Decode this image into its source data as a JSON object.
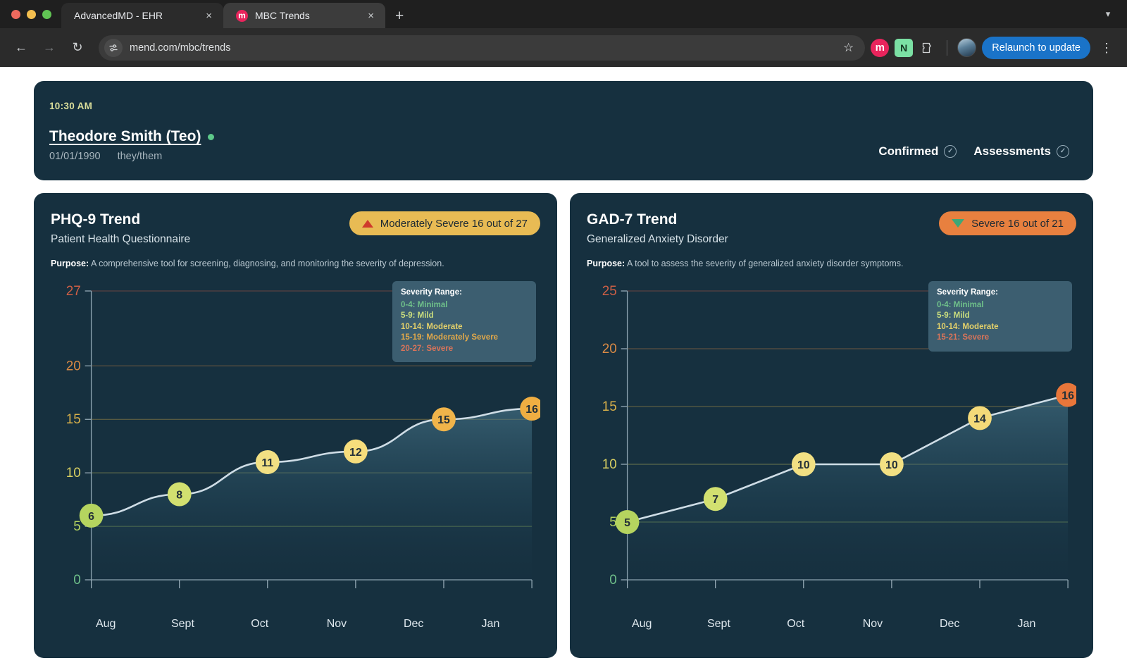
{
  "browser": {
    "tabs": [
      {
        "title": "AdvancedMD - EHR",
        "favicon": "",
        "active": false,
        "close_label": "×"
      },
      {
        "title": "MBC Trends",
        "favicon": "m",
        "active": true,
        "close_label": "×"
      }
    ],
    "new_tab_label": "+",
    "tabstrip_collapse_icon": "chevron-down-icon",
    "back_icon": "←",
    "forward_icon": "→",
    "reload_icon": "↻",
    "site_info_icon": "tune-icon",
    "url": "mend.com/mbc/trends",
    "bookmark_icon": "☆",
    "extensions": [
      {
        "name": "mend-extension",
        "glyph": "m",
        "color": "#e8245c"
      },
      {
        "name": "notion-extension",
        "glyph": "N",
        "color": "#7be0a4"
      },
      {
        "name": "extensions-puzzle",
        "glyph": "⬡",
        "color": "#d0d2d4"
      }
    ],
    "relaunch_label": "Relaunch to update",
    "menu_icon": "⋮"
  },
  "header": {
    "time": "10:30 AM",
    "patient_name": "Theodore Smith (Teo)",
    "online_status": "online",
    "dob": "01/01/1990",
    "pronouns": "they/them",
    "chips": [
      {
        "label": "Confirmed",
        "icon": "check-circle-icon"
      },
      {
        "label": "Assessments",
        "icon": "check-circle-icon"
      }
    ]
  },
  "colors": {
    "card_bg": "#16303f",
    "legend_bg": "#3c5e70",
    "accent_blue": "#1a73c8",
    "minimal": "#6fc08a",
    "mild": "#c9dd7e",
    "moderate": "#e3d06a",
    "moderately_severe": "#e0a84a",
    "severe": "#d9745a",
    "line": "#cfdde6"
  },
  "charts": [
    {
      "title": "PHQ-9 Trend",
      "subtitle": "Patient Health Questionnaire",
      "purpose_label": "Purpose:",
      "purpose_text": "A comprehensive tool for screening, diagnosing, and monitoring the severity of depression.",
      "badge": {
        "text": "Moderately Severe 16 out of 27",
        "bg": "#e8bb54",
        "arrow": "up",
        "arrow_color": "#cf3a2c"
      },
      "legend": {
        "title": "Severity Range:",
        "items": [
          {
            "text": "0-4: Minimal",
            "color": "#6fc08a"
          },
          {
            "text": "5-9: Mild",
            "color": "#c9dd7e"
          },
          {
            "text": "10-14: Moderate",
            "color": "#e3d06a"
          },
          {
            "text": "15-19: Moderately Severe",
            "color": "#e0a84a"
          },
          {
            "text": "20-27: Severe",
            "color": "#d9745a"
          }
        ]
      }
    },
    {
      "title": "GAD-7 Trend",
      "subtitle": "Generalized Anxiety Disorder",
      "purpose_label": "Purpose:",
      "purpose_text": "A tool to assess the severity of generalized anxiety disorder symptoms.",
      "badge": {
        "text": "Severe 16 out of 21",
        "bg": "#e8803f",
        "arrow": "down",
        "arrow_color": "#3ea777"
      },
      "legend": {
        "title": "Severity Range:",
        "items": [
          {
            "text": "0-4: Minimal",
            "color": "#6fc08a"
          },
          {
            "text": "5-9: Mild",
            "color": "#c9dd7e"
          },
          {
            "text": "10-14: Moderate",
            "color": "#e3d06a"
          },
          {
            "text": "15-21: Severe",
            "color": "#d9745a"
          }
        ]
      }
    }
  ],
  "chart_data": [
    {
      "type": "line",
      "title": "PHQ-9 Trend",
      "subtitle": "Patient Health Questionnaire",
      "xlabel": "",
      "ylabel": "",
      "categories": [
        "Aug",
        "Sept",
        "Oct",
        "Nov",
        "Dec",
        "Jan"
      ],
      "values": [
        6,
        8,
        11,
        12,
        15,
        16
      ],
      "point_colors": [
        "#b5d45f",
        "#d2e070",
        "#f2e083",
        "#f6dd7c",
        "#f0b44a",
        "#efae42"
      ],
      "yticks": [
        0,
        5,
        10,
        15,
        20,
        27
      ],
      "ytick_colors": [
        "#6fc08a",
        "#b5d45f",
        "#d8cf62",
        "#d8b04a",
        "#d98a45",
        "#cf5f45"
      ],
      "ylim": [
        0,
        27
      ],
      "grid": true,
      "legend_position": "top-right",
      "area_fill": true
    },
    {
      "type": "line",
      "title": "GAD-7 Trend",
      "subtitle": "Generalized Anxiety Disorder",
      "xlabel": "",
      "ylabel": "",
      "categories": [
        "Aug",
        "Sept",
        "Oct",
        "Nov",
        "Dec",
        "Jan"
      ],
      "values": [
        5,
        7,
        10,
        10,
        14,
        16
      ],
      "point_colors": [
        "#b5d45f",
        "#d2e070",
        "#f2e083",
        "#f2e083",
        "#f4da79",
        "#e8763a"
      ],
      "yticks": [
        0,
        5,
        10,
        15,
        20,
        25
      ],
      "ytick_colors": [
        "#6fc08a",
        "#b5d45f",
        "#d8cf62",
        "#d8b04a",
        "#d98a45",
        "#cf5f45"
      ],
      "ylim": [
        0,
        25
      ],
      "grid": true,
      "legend_position": "top-right",
      "area_fill": true
    }
  ]
}
